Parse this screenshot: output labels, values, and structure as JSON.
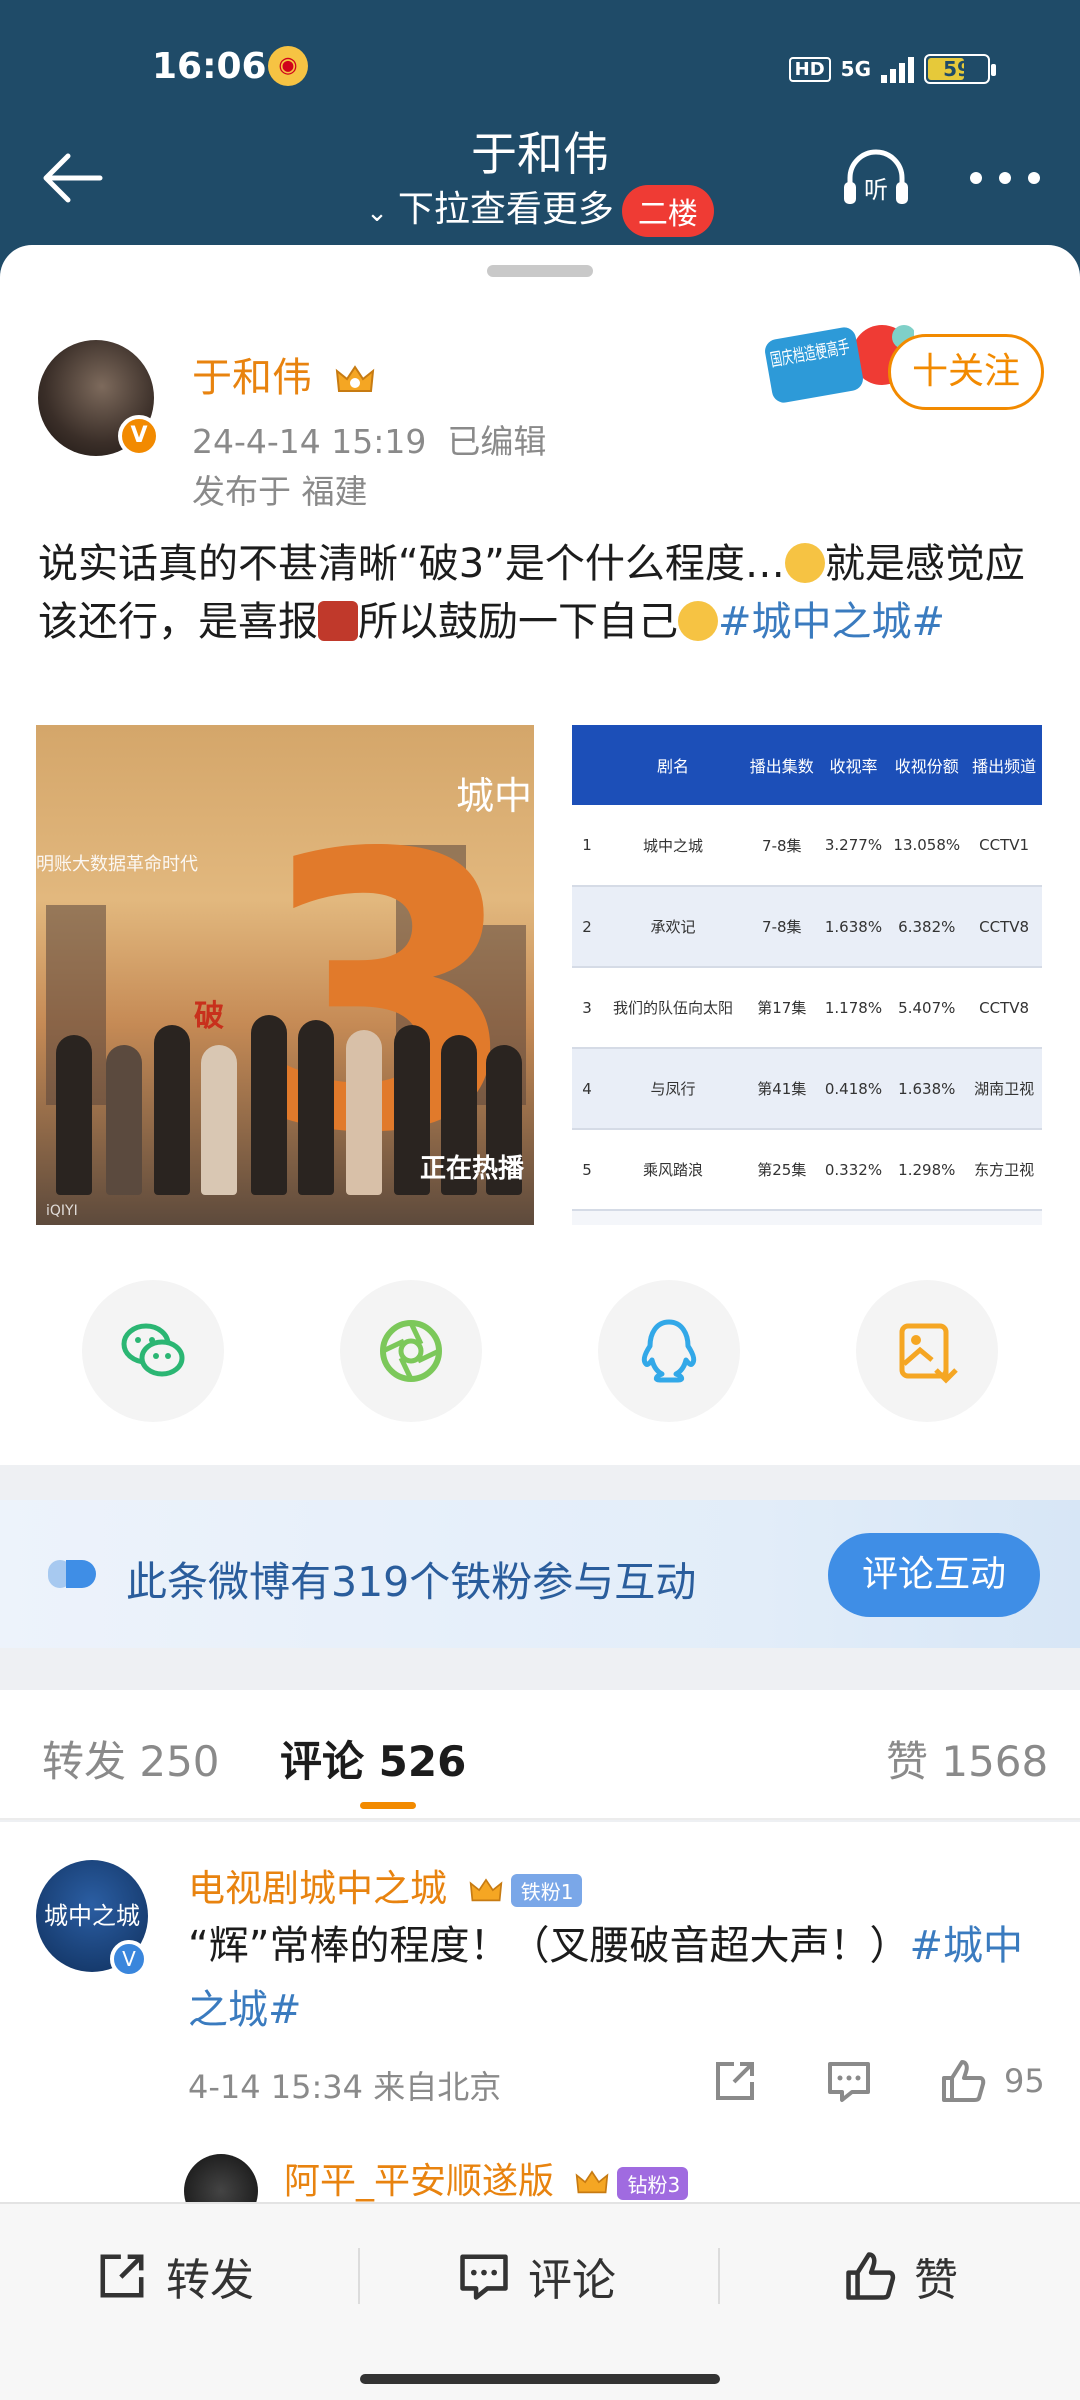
{
  "status_bar": {
    "time": "16:06",
    "network": "5G",
    "hd": "HD",
    "battery": "59"
  },
  "header": {
    "title": "于和伟",
    "subtitle": "下拉查看更多",
    "floor_badge": "二楼"
  },
  "post": {
    "author": "于和伟",
    "date": "24-4-14 15:19",
    "edited": "已编辑",
    "location": "发布于 福建",
    "follow_label": "十关注",
    "badge_text": "国庆档造梗高手",
    "text_part1": "说实话真的不甚清晰“破3”是个什么程度…",
    "text_part2": "就是感觉应该还行，是喜报",
    "text_part3": "所以鼓励一下自己",
    "hashtag": "#城中之城#",
    "image1": {
      "slogan": "明账大数据革命时代",
      "po": "破",
      "big": "3",
      "city": "城中",
      "hot": "正在热播",
      "footer": "iQIYI"
    },
    "image2": {
      "headers": [
        "剧名",
        "播出集数",
        "收视率",
        "收视份额",
        "播出频道"
      ],
      "rows": [
        [
          "1",
          "城中之城",
          "7-8集",
          "3.277%",
          "13.058%",
          "CCTV1"
        ],
        [
          "2",
          "承欢记",
          "7-8集",
          "1.638%",
          "6.382%",
          "CCTV8"
        ],
        [
          "3",
          "我们的队伍向太阳",
          "第17集",
          "1.178%",
          "5.407%",
          "CCTV8"
        ],
        [
          "4",
          "与凤行",
          "第41集",
          "0.418%",
          "1.638%",
          "湖南卫视"
        ],
        [
          "5",
          "乘风踏浪",
          "第25集",
          "0.332%",
          "1.298%",
          "东方卫视"
        ]
      ]
    }
  },
  "share_icons": [
    "wechat-icon",
    "moments-icon",
    "qq-icon",
    "save-image-icon"
  ],
  "fans_banner": {
    "text": "此条微博有319个铁粉参与互动",
    "button": "评论互动"
  },
  "tabs": {
    "repost": "转发 250",
    "comment": "评论 526",
    "like": "赞 1568"
  },
  "comments": [
    {
      "name": "电视剧城中之城",
      "avatar_text": "城中之城",
      "badge": "铁粉1",
      "text": "“辉”常棒的程度！（叉腰破音超大声！）",
      "hashtag": "#城中之城#",
      "time": "4-14 15:34",
      "location": "来自北京",
      "likes": "95"
    }
  ],
  "sub_comment": {
    "name": "阿平_平安顺遂版",
    "badge": "钻粉3"
  },
  "bottom_bar": {
    "repost": "转发",
    "comment": "评论",
    "like": "赞"
  },
  "colors": {
    "header_bg": "#1f4b68",
    "accent": "#f28a00",
    "link": "#3a7bbf",
    "floor_badge": "#ef3b34"
  }
}
